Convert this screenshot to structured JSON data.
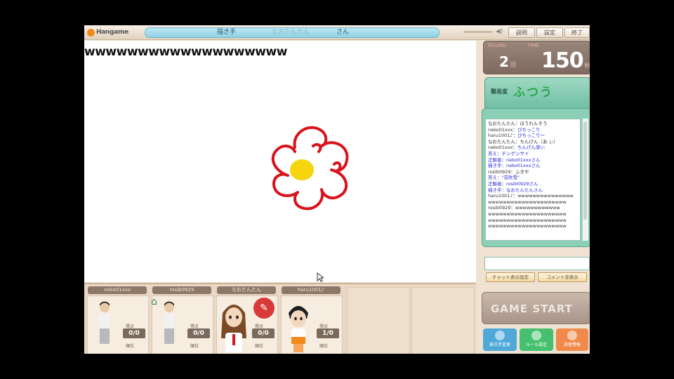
{
  "header": {
    "logo": "Hangame",
    "topic_segments": [
      "描き手",
      "なおたんたん",
      "さん"
    ],
    "buttons": [
      "説明",
      "設定",
      "終了"
    ]
  },
  "canvas": {
    "chat_text": "wwwwwwwwwwwwwwwwwww",
    "drawing": "red-flower-with-yellow-center"
  },
  "players": [
    {
      "name": "neko01xxx",
      "points_label": "得点",
      "score": "0/0",
      "rank_label": "順位"
    },
    {
      "name": "rosib0929",
      "points_label": "得点",
      "score": "0/0",
      "rank_label": "順位"
    },
    {
      "name": "なおたんたん",
      "points_label": "得点",
      "score": "0/0",
      "rank_label": "順位"
    },
    {
      "name": "haru1001♪",
      "points_label": "得点",
      "score": "1/0",
      "rank_label": "順位"
    }
  ],
  "status": {
    "round_label": "ROUND",
    "round_value": "2",
    "round_unit": "回",
    "timer_label": "TIME",
    "timer_value": "150",
    "timer_unit": "秒"
  },
  "question": {
    "label": "難易度",
    "word": "ふつう"
  },
  "chat": {
    "entries": [
      {
        "user": "なおたんたん：",
        "msg": "ほうれんそう",
        "kind": "plain"
      },
      {
        "user": "neko01xxx：",
        "msg": "ぴちっこり",
        "kind": "normal"
      },
      {
        "user": "haru1001♪：",
        "msg": "ぴちっこりー",
        "kind": "normal"
      },
      {
        "user": "なおたんたん：",
        "msg": "ちんげん（あ ぃ）",
        "kind": "plain"
      },
      {
        "user": "neko01xxx：",
        "msg": "ちんげん菜い",
        "kind": "normal"
      },
      {
        "user": "",
        "msg": "答え：チンゲンサイ",
        "kind": "sys"
      },
      {
        "user": "",
        "msg": "正解者：neko01xxxさん",
        "kind": "sys"
      },
      {
        "user": "",
        "msg": "描き手：neko01xxxさん",
        "kind": "sys"
      },
      {
        "user": "rosib0929：",
        "msg": "ふきや",
        "kind": "plain"
      },
      {
        "user": "",
        "msg": "答え：\"花吹雪\"",
        "kind": "sys"
      },
      {
        "user": "",
        "msg": "正解者：rosib0929さん",
        "kind": "sys"
      },
      {
        "user": "",
        "msg": "描き手：なおたんたんさん",
        "kind": "sys"
      },
      {
        "user": "haru1001♪：",
        "msg": "wwwwwwwwwwwwwww",
        "kind": "plain"
      },
      {
        "user": "",
        "msg": "wwwwwwwwwwwwwwwwwwwww",
        "kind": "plain"
      },
      {
        "user": "rosib0929：",
        "msg": "wwwwwwwwwwww",
        "kind": "plain"
      },
      {
        "user": "",
        "msg": "wwwwwwwwwwwwwwwwwwwww",
        "kind": "plain"
      },
      {
        "user": "",
        "msg": "wwwwwwwwwwwwwwwwwwwww",
        "kind": "plain"
      },
      {
        "user": "",
        "msg": "wwwwwwwwwwwwwwwwwwwww",
        "kind": "plain"
      }
    ],
    "input_value": "",
    "buttons": [
      "チャット表示設定",
      "コメント非表示"
    ]
  },
  "start_button": "GAME START",
  "bottom_buttons": [
    {
      "label": "描き手変更",
      "color": "#4fa9d8"
    },
    {
      "label": "ルール設定",
      "color": "#46c06e"
    },
    {
      "label": "部屋情報",
      "color": "#f08a4b"
    }
  ],
  "colors": {
    "flower_stroke": "#d8131b",
    "flower_center": "#f6d50f"
  }
}
